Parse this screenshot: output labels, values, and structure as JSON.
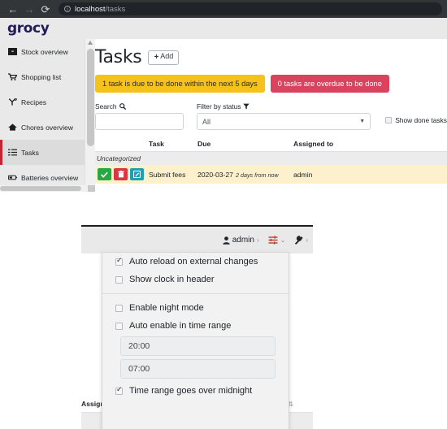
{
  "browser": {
    "back_icon": "←",
    "forward_icon": "→",
    "reload_icon": "⟳",
    "info_icon": "i",
    "url_host": "localhost",
    "url_path": "/tasks"
  },
  "app": {
    "logo": "grocy"
  },
  "sidebar": {
    "items": [
      {
        "label": "Stock overview",
        "icon": "box-icon"
      },
      {
        "label": "Shopping list",
        "icon": "cart-icon"
      },
      {
        "label": "Recipes",
        "icon": "recipe-icon"
      },
      {
        "label": "Chores overview",
        "icon": "home-icon"
      },
      {
        "label": "Tasks",
        "icon": "tasks-icon",
        "active": true
      },
      {
        "label": "Batteries overview",
        "icon": "battery-icon"
      }
    ]
  },
  "main": {
    "title": "Tasks",
    "add_button": "Add",
    "add_plus": "+",
    "alerts": [
      {
        "text": "1 task is due to be done within the next 5 days",
        "style": "warning",
        "color": "#f5c21b"
      },
      {
        "text": "0 tasks are overdue to be done",
        "style": "danger",
        "color": "#d9435e"
      }
    ],
    "filters": {
      "search_label": "Search",
      "search_icon": "search-icon",
      "search_value": "",
      "search_placeholder": "",
      "status_label": "Filter by status",
      "status_icon": "filter-icon",
      "status_value": "All",
      "status_options": [
        "All"
      ],
      "show_done_label": "Show done tasks",
      "show_done_checked": false
    },
    "table": {
      "headers": [
        "",
        "Task",
        "Due",
        "Assigned to"
      ],
      "group_label": "Uncategorized",
      "rows": [
        {
          "task": "Submit fees",
          "due_date": "2020-03-27",
          "due_relative": "2 days from now",
          "assigned_to": "admin",
          "actions": [
            {
              "name": "done-button",
              "icon": "✔",
              "color": "#28a745"
            },
            {
              "name": "delete-button",
              "icon": "🗑",
              "color": "#dc3545"
            },
            {
              "name": "edit-button",
              "icon": "✎",
              "color": "#17a2b8"
            }
          ]
        }
      ]
    }
  },
  "lower_window": {
    "header": {
      "user_label": "admin",
      "user_icon": "user-icon",
      "chevron": "›",
      "sliders_icon": "sliders-icon",
      "sliders_caret": "⌄",
      "wrench_icon": "wrench-icon",
      "wrench_chevron": "›"
    },
    "occluded_header": "Assigned to",
    "sort_icon": "sort-icon"
  },
  "menu": {
    "items_top": [
      {
        "label": "Auto reload on external changes",
        "checked": true
      },
      {
        "label": "Show clock in header",
        "checked": false
      }
    ],
    "items_bottom": [
      {
        "label": "Enable night mode",
        "checked": false
      },
      {
        "label": "Auto enable in time range",
        "checked": false
      }
    ],
    "time_start": "20:00",
    "time_end": "07:00",
    "midnight_label": "Time range goes over midnight",
    "midnight_checked": true
  }
}
